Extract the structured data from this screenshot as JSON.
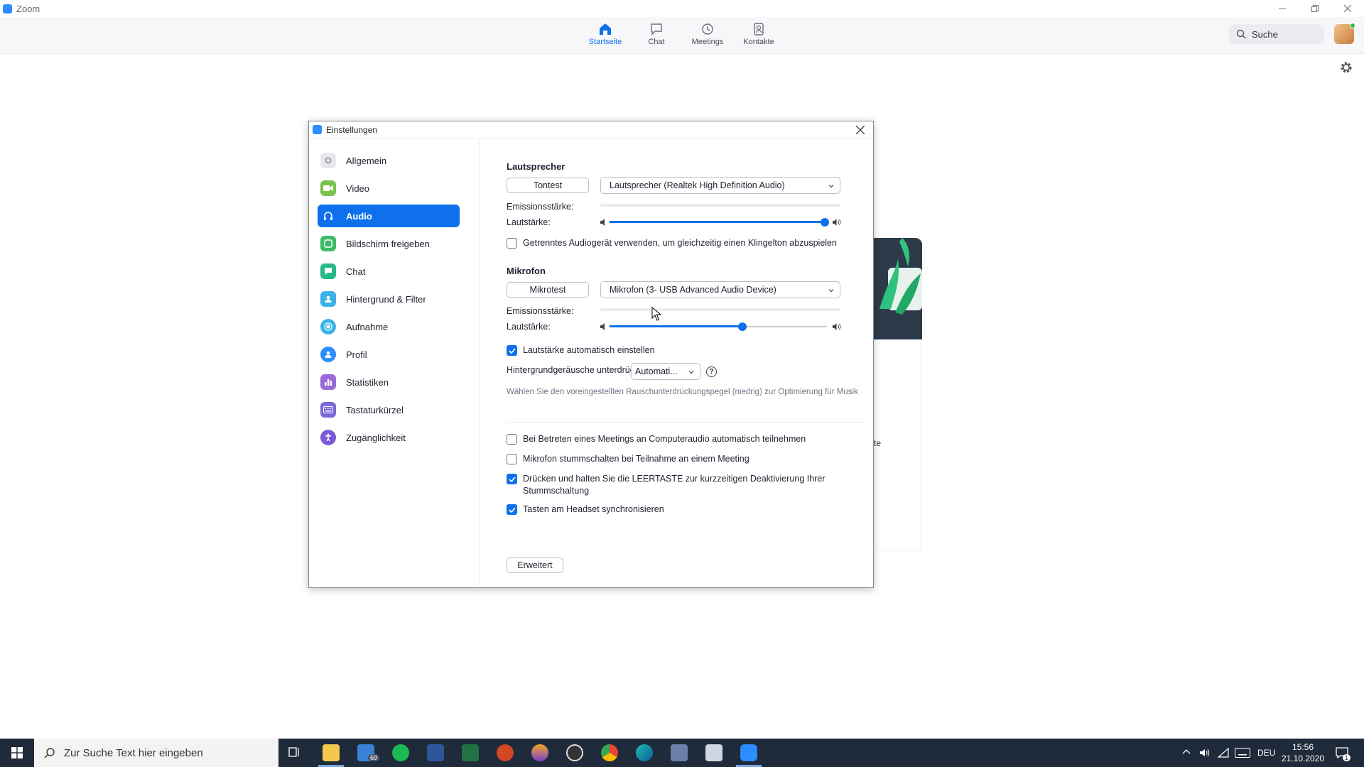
{
  "window": {
    "title": "Zoom"
  },
  "nav": {
    "tabs": [
      {
        "label": "Startseite",
        "active": true
      },
      {
        "label": "Chat"
      },
      {
        "label": "Meetings"
      },
      {
        "label": "Kontakte"
      }
    ],
    "search_label": "Suche"
  },
  "background": {
    "partial_text": "te"
  },
  "dialog": {
    "title": "Einstellungen",
    "sidebar": [
      {
        "label": "Allgemein",
        "icon": "gear-icon",
        "color": "#9b9bab"
      },
      {
        "label": "Video",
        "icon": "video-icon",
        "color": "#7ac24f"
      },
      {
        "label": "Audio",
        "icon": "headphones-icon",
        "color": "#0e71eb",
        "active": true
      },
      {
        "label": "Bildschirm freigeben",
        "icon": "share-screen-icon",
        "color": "#3dbb68"
      },
      {
        "label": "Chat",
        "icon": "chat-icon",
        "color": "#27b889"
      },
      {
        "label": "Hintergrund & Filter",
        "icon": "background-icon",
        "color": "#3bb3e8"
      },
      {
        "label": "Aufnahme",
        "icon": "record-icon",
        "color": "#3bb3e8"
      },
      {
        "label": "Profil",
        "icon": "profile-icon",
        "color": "#2d8cff"
      },
      {
        "label": "Statistiken",
        "icon": "statistics-icon",
        "color": "#9a6ad6"
      },
      {
        "label": "Tastaturkürzel",
        "icon": "keyboard-icon",
        "color": "#7a6ad6"
      },
      {
        "label": "Zugänglichkeit",
        "icon": "accessibility-icon",
        "color": "#7a5ad6"
      }
    ],
    "speaker": {
      "heading": "Lautsprecher",
      "test_button": "Tontest",
      "device": "Lautsprecher (Realtek High Definition Audio)",
      "output_level_label": "Emissionsstärke:",
      "volume_label": "Lautstärke:",
      "volume_fraction": 0.99
    },
    "separate_audio_checkbox": {
      "label": "Getrenntes Audiogerät verwenden, um gleichzeitig einen Klingelton abzuspielen",
      "checked": false
    },
    "microphone": {
      "heading": "Mikrofon",
      "test_button": "Mikrotest",
      "device": "Mikrofon (3- USB Advanced Audio Device)",
      "input_level_label": "Emissionsstärke:",
      "volume_label": "Lautstärke:",
      "volume_fraction": 0.61
    },
    "auto_volume_checkbox": {
      "label": "Lautstärke automatisch einstellen",
      "checked": true
    },
    "noise_suppression": {
      "label": "Hintergrundgeräusche unterdrücken",
      "value": "Automati...",
      "help_icon": "?",
      "hint": "Wählen Sie den voreingestellten Rauschunterdrückungspegel (niedrig) zur Optimierung für Musik"
    },
    "checkboxes": [
      {
        "label": "Bei Betreten eines Meetings an Computeraudio automatisch teilnehmen",
        "checked": false
      },
      {
        "label": "Mikrofon stummschalten bei Teilnahme an einem Meeting",
        "checked": false
      },
      {
        "label": "Drücken und halten Sie die LEERTASTE zur kurzzeitigen Deaktivierung Ihrer Stummschaltung",
        "checked": true
      },
      {
        "label": "Tasten am Headset synchronisieren",
        "checked": true
      }
    ],
    "advanced_button": "Erweitert"
  },
  "taskbar": {
    "search_placeholder": "Zur Suche Text hier eingeben",
    "mail_badge": "69",
    "language": "DEU",
    "time": "15:56",
    "date": "21.10.2020",
    "notification_count": "1"
  }
}
